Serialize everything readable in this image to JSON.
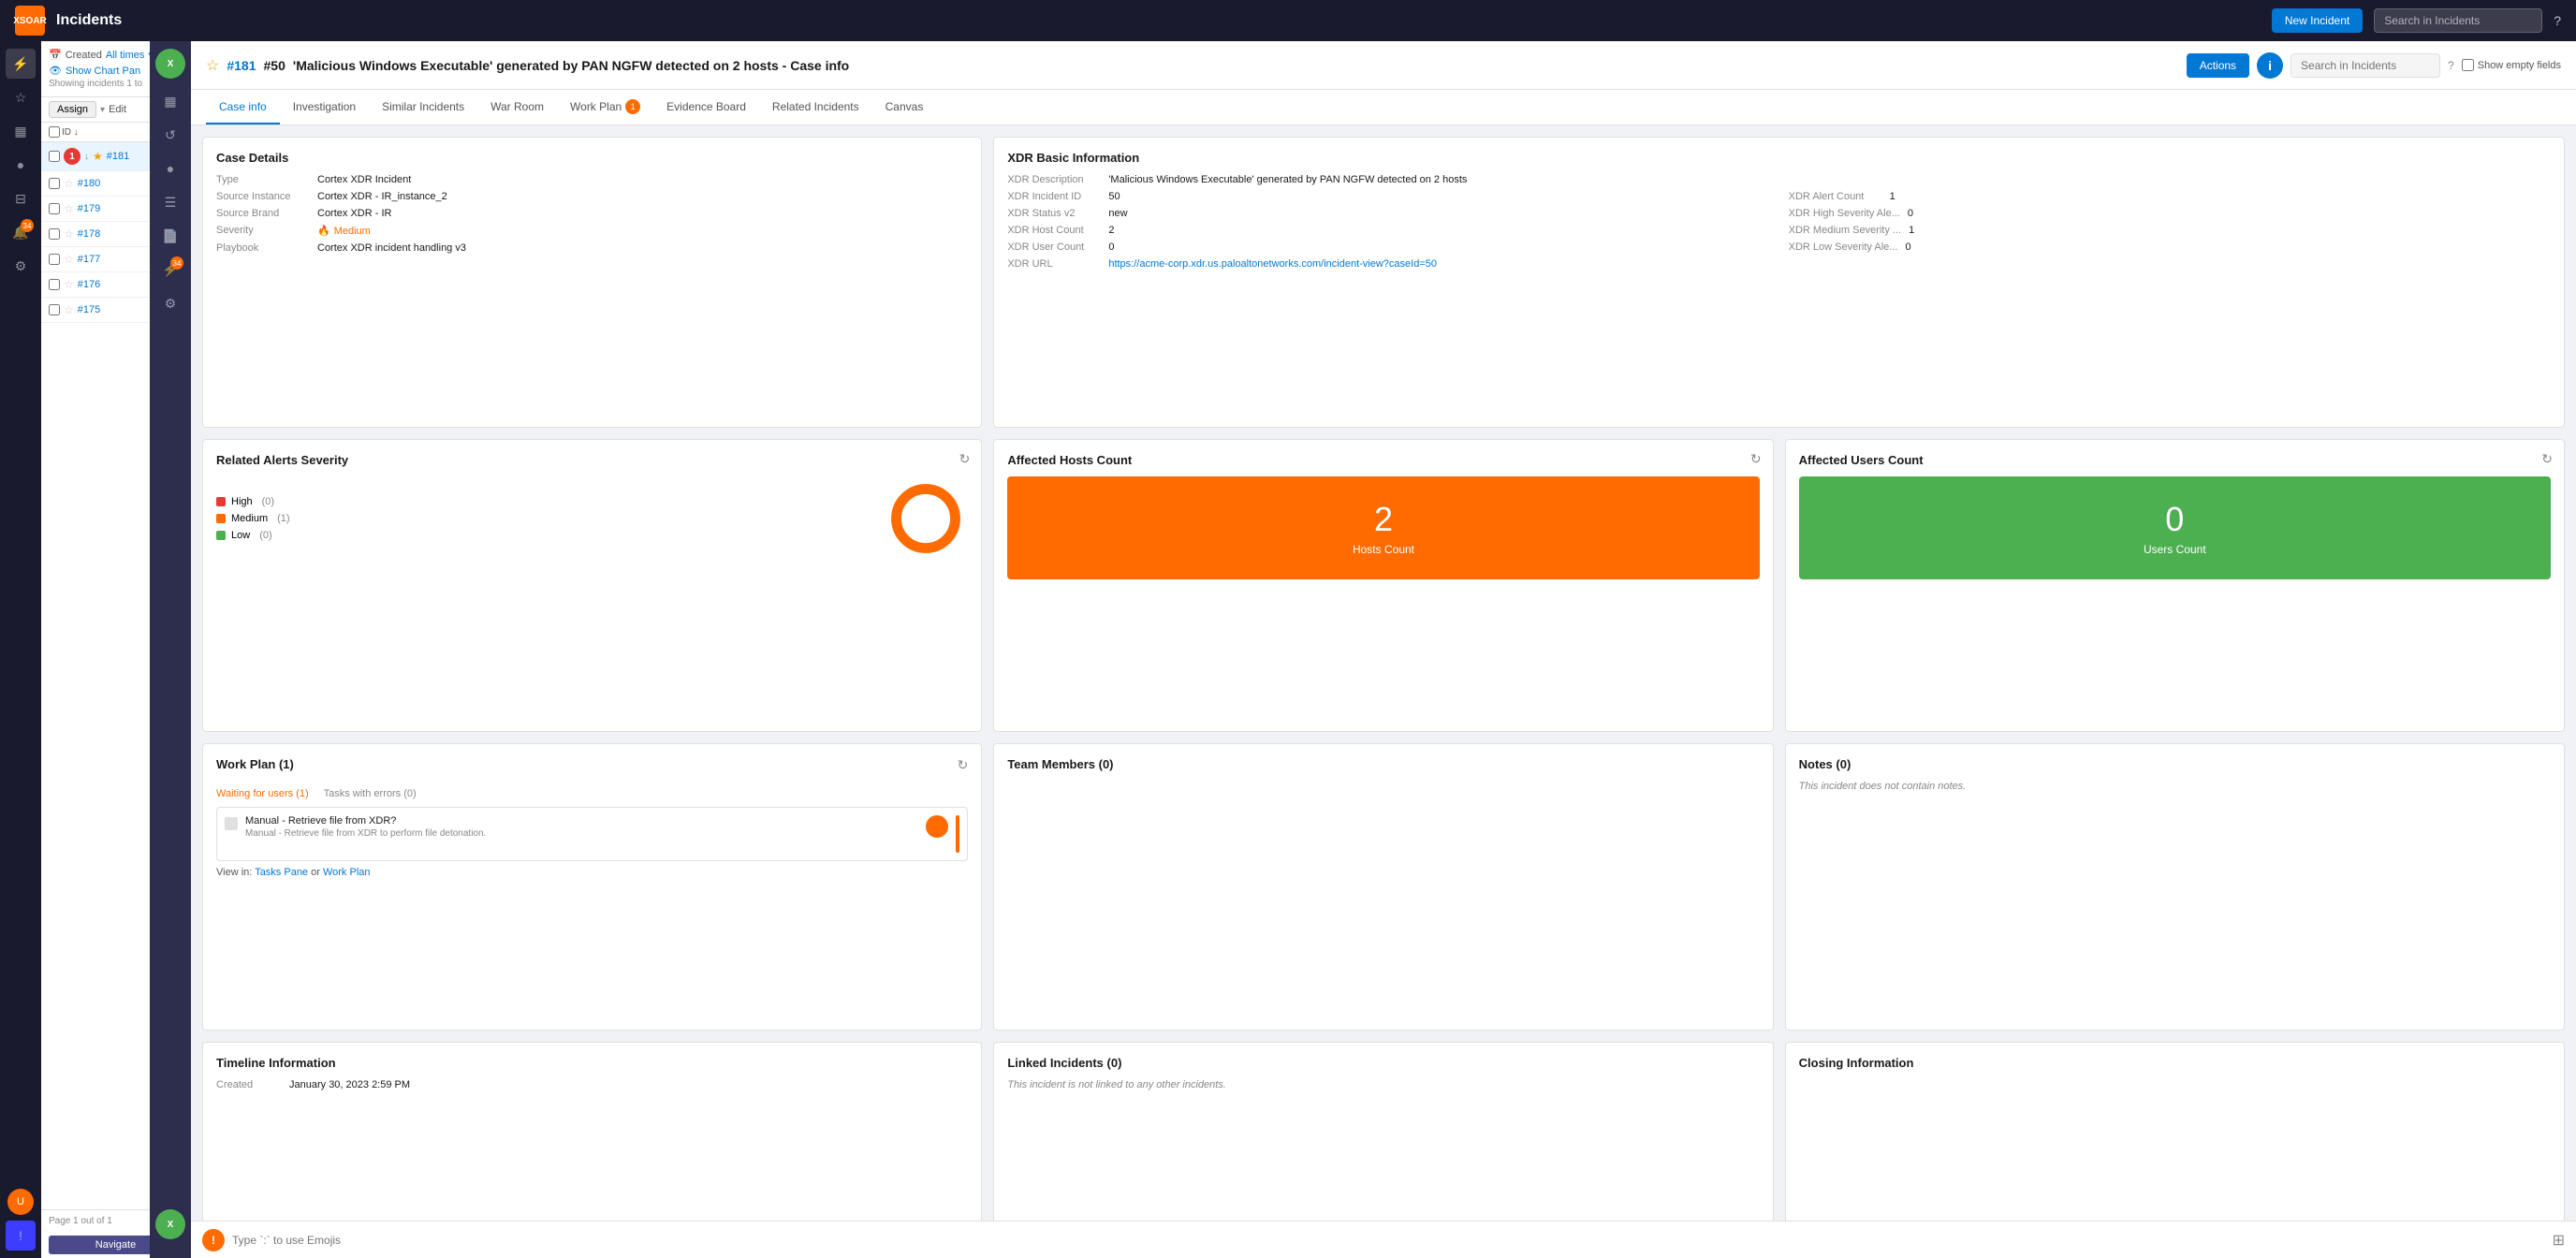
{
  "topbar": {
    "logo": "XSOAR",
    "title": "Incidents",
    "new_incident": "New Incident",
    "search_placeholder": "Search in Incidents",
    "help": "?"
  },
  "incidents_panel": {
    "filter_label": "Created",
    "filter_value": "All times",
    "show_chart": "Show Chart Pan",
    "showing": "Showing incidents 1 to",
    "assign": "Assign",
    "edit": "Edit",
    "id_sort": "ID ↓",
    "page_info": "Page 1 out of 1",
    "navigate": "Navigate",
    "incidents": [
      {
        "num": "#181",
        "active": true
      },
      {
        "num": "#180",
        "active": false
      },
      {
        "num": "#179",
        "active": false
      },
      {
        "num": "#178",
        "active": false
      },
      {
        "num": "#177",
        "active": false
      },
      {
        "num": "#176",
        "active": false
      },
      {
        "num": "#175",
        "active": false
      }
    ]
  },
  "detail_header": {
    "star": "☆",
    "id": "#181",
    "incident_num": "#50",
    "title": "'Malicious Windows Executable' generated by PAN NGFW detected on 2 hosts - Case info",
    "actions": "Actions",
    "search_placeholder": "Search in Incidents",
    "help": "?",
    "show_empty": "Show empty fields"
  },
  "tabs": [
    {
      "label": "Case info",
      "active": true
    },
    {
      "label": "Investigation",
      "active": false
    },
    {
      "label": "Similar Incidents",
      "active": false
    },
    {
      "label": "War Room",
      "active": false
    },
    {
      "label": "Work Plan",
      "active": false,
      "badge": true
    },
    {
      "label": "Evidence Board",
      "active": false
    },
    {
      "label": "Related Incidents",
      "active": false
    },
    {
      "label": "Canvas",
      "active": false
    }
  ],
  "case_details": {
    "title": "Case Details",
    "type_label": "Type",
    "type_value": "Cortex XDR Incident",
    "source_instance_label": "Source Instance",
    "source_instance_value": "Cortex XDR - IR_instance_2",
    "source_brand_label": "Source Brand",
    "source_brand_value": "Cortex XDR - IR",
    "severity_label": "Severity",
    "severity_value": "Medium",
    "playbook_label": "Playbook",
    "playbook_value": "Cortex XDR incident handling v3"
  },
  "xdr_info": {
    "title": "XDR Basic Information",
    "description_label": "XDR Description",
    "description_value": "'Malicious Windows Executable' generated by PAN NGFW detected on 2 hosts",
    "incident_id_label": "XDR Incident ID",
    "incident_id_value": "50",
    "status_label": "XDR Status v2",
    "status_value": "new",
    "host_count_label": "XDR Host Count",
    "host_count_value": "2",
    "user_count_label": "XDR User Count",
    "user_count_value": "0",
    "url_label": "XDR URL",
    "url_value": "https://acme-corp.xdr.us.paloaltonetworks.com/incident-view?caseId=50",
    "alert_count_label": "XDR Alert Count",
    "alert_count_value": "1",
    "high_severity_label": "XDR High Severity Ale...",
    "high_severity_value": "0",
    "medium_severity_label": "XDR Medium Severity ...",
    "medium_severity_value": "1",
    "low_severity_label": "XDR Low Severity Ale...",
    "low_severity_value": "0"
  },
  "related_alerts": {
    "title": "Related Alerts Severity",
    "high_label": "High",
    "high_count": "(0)",
    "medium_label": "Medium",
    "medium_count": "(1)",
    "low_label": "Low",
    "low_count": "(0)"
  },
  "hosts_count": {
    "title": "Affected Hosts Count",
    "count": "2",
    "label": "Hosts Count"
  },
  "users_count": {
    "title": "Affected Users Count",
    "count": "0",
    "label": "Users Count"
  },
  "work_plan": {
    "title": "Work Plan (1)",
    "waiting": "Waiting for users (1)",
    "errors": "Tasks with errors (0)",
    "task_title": "Manual - Retrieve file from XDR?",
    "task_desc": "Manual - Retrieve file from XDR to perform file detonation.",
    "view_prefix": "View in: ",
    "tasks_pane": "Tasks Pane",
    "or": "or",
    "work_plan_link": "Work Plan"
  },
  "team_members": {
    "title": "Team Members (0)"
  },
  "notes": {
    "title": "Notes (0)",
    "empty_text": "This incident does not contain notes."
  },
  "timeline": {
    "title": "Timeline Information",
    "created_label": "Created",
    "created_value": "January 30, 2023 2:59 PM"
  },
  "linked_incidents": {
    "title": "Linked Incidents (0)",
    "empty_text": "This incident is not linked to any other incidents."
  },
  "closing_info": {
    "title": "Closing Information"
  },
  "chat": {
    "placeholder": "Type `:` to use Emojis"
  },
  "colors": {
    "orange": "#ff6b00",
    "green": "#4CAF50",
    "blue": "#0078d4",
    "red": "#e53935"
  }
}
